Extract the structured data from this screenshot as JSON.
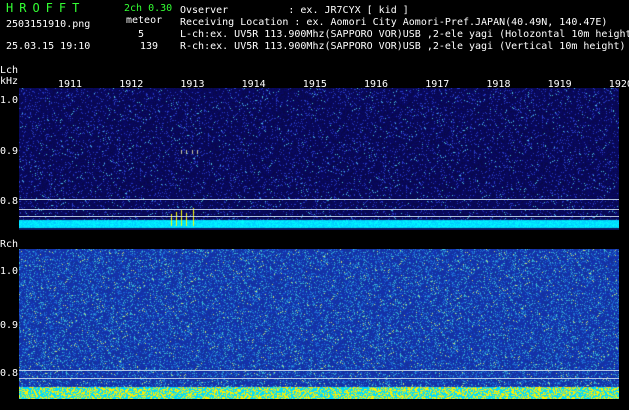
{
  "header": {
    "app_title": "HROFFT",
    "version": "2ch 0.30",
    "filename": "2503151910.png",
    "datetime": "25.03.15 19:10",
    "meteor_label": "meteor",
    "meteor_count": "5",
    "total_count": "139"
  },
  "info": {
    "observer": "Ovserver          : ex. JR7CYX [ kid ]",
    "location": "Receiving Location : ex. Aomori City Aomori-Pref.JAPAN(40.49N, 140.47E)",
    "lch_desc": "L-ch:ex. UV5R 113.900Mhz(SAPPORO VOR)USB ,2-ele yagi (Holozontal 10m height",
    "rch_desc": "R-ch:ex. UV5R 113.900Mhz(SAPPORO VOR)USB ,2-ele yagi (Vertical 10m height)"
  },
  "lch": {
    "label": "Lch",
    "unit": "kHz",
    "freq_labels": [
      "1.0",
      "0.9",
      "0.8"
    ]
  },
  "rch": {
    "label": "Rch",
    "freq_labels": [
      "1.0",
      "0.9",
      "0.8"
    ]
  },
  "time_axis": [
    "1911",
    "1912",
    "1913",
    "1914",
    "1915",
    "1916",
    "1917",
    "1918",
    "1919",
    "1920"
  ],
  "colors": {
    "background": "#000000",
    "lch_noise_bg": "#0a0a5a",
    "rch_noise_bg": "#1a3a9a",
    "signal_band": "#00e5ff",
    "meteor_trace": "#ffff00",
    "title_green": "#33ff33"
  }
}
